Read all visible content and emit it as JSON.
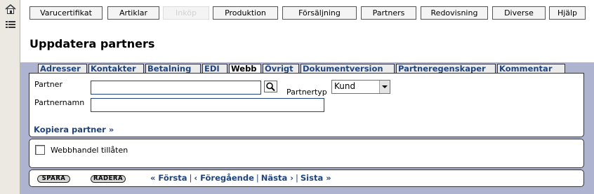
{
  "menu": [
    "Varucertifikat",
    "Artiklar",
    "Inköp",
    "Produktion",
    "Försäljning",
    "Partners",
    "Redovisning",
    "Diverse",
    "Hjälp"
  ],
  "menu_disabled": "Inköp",
  "page": {
    "title": "Uppdatera partners"
  },
  "tabs": [
    "Adresser",
    "Kontakter",
    "Betalning",
    "EDI",
    "Webb",
    "Övrigt",
    "Dokumentversion",
    "Partneregenskaper",
    "Kommentar"
  ],
  "active_tab": "Webb",
  "form": {
    "partner_label": "Partner",
    "partner_value": "",
    "partnertyp_label": "Partnertyp",
    "partnertyp_value": "Kund",
    "partnernamn_label": "Partnernamn",
    "partnernamn_value": "",
    "copy_link": "Kopiera partner »"
  },
  "web": {
    "checkbox_label": "Webbhandel tillåten",
    "checked": false
  },
  "actions": {
    "save": "SPARA",
    "delete": "RADERA"
  },
  "pager": {
    "first": "« Första",
    "prev": "‹ Föregående",
    "next": "Nästa ›",
    "last": "Sista »",
    "separator": "|"
  },
  "colors": {
    "background": "#aeb3cf",
    "link": "#20447c"
  }
}
